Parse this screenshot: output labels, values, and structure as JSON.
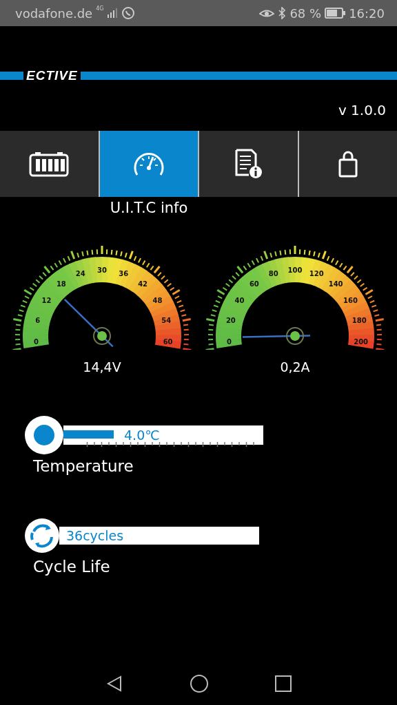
{
  "status_bar": {
    "carrier": "vodafone.de",
    "network": "4G",
    "battery": "68 %",
    "time": "16:20"
  },
  "header": {
    "logo": "ECTIVE",
    "version": "v 1.0.0"
  },
  "tabs": [
    {
      "kind": "battery",
      "selected": false
    },
    {
      "kind": "gauge",
      "selected": true
    },
    {
      "kind": "info",
      "selected": false
    },
    {
      "kind": "bag",
      "selected": false
    }
  ],
  "section_title": "U.I.T.C info",
  "gauges": [
    {
      "ticks": [
        "0",
        "6",
        "12",
        "18",
        "24",
        "30",
        "36",
        "42",
        "48",
        "54",
        "60"
      ],
      "reading": "14,4V"
    },
    {
      "ticks": [
        "0",
        "20",
        "40",
        "60",
        "80",
        "100",
        "120",
        "140",
        "160",
        "180",
        "200"
      ],
      "reading": "0,2A"
    }
  ],
  "bars": [
    {
      "kind": "thermometer",
      "value": "4.0℃",
      "label": "Temperature",
      "level": 0.25
    },
    {
      "kind": "cycles",
      "value": "36cycles",
      "label": "Cycle Life"
    }
  ]
}
